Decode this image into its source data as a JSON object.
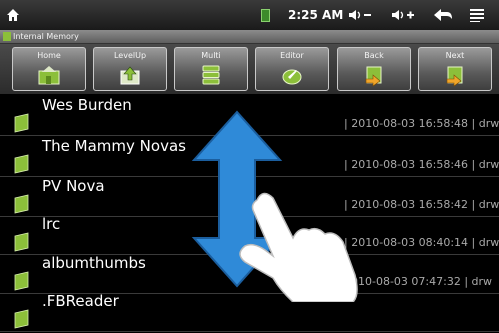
{
  "status": {
    "time": "2:25 AM",
    "icons": [
      "home-icon",
      "battery-icon",
      "volume-down-icon",
      "volume-up-icon",
      "back-arrow-icon",
      "menu-icon"
    ],
    "volume_down_label": "◀)−",
    "volume_up_label": "◀)+"
  },
  "path": {
    "label": "Internal Memory"
  },
  "toolbar": {
    "buttons": [
      {
        "label": "Home",
        "icon": "home-folder-icon"
      },
      {
        "label": "LevelUp",
        "icon": "level-up-icon"
      },
      {
        "label": "Multi",
        "icon": "multi-select-icon"
      },
      {
        "label": "Editor",
        "icon": "editor-icon"
      },
      {
        "label": "Back",
        "icon": "back-folder-icon"
      },
      {
        "label": "Next",
        "icon": "next-folder-icon"
      }
    ]
  },
  "files": [
    {
      "name": "Wes Burden",
      "meta": "| 2010-08-03 16:58:48 | drw"
    },
    {
      "name": "The Mammy Novas",
      "meta": "| 2010-08-03 16:58:46 | drw"
    },
    {
      "name": "PV Nova",
      "meta": "| 2010-08-03 16:58:42 | drw"
    },
    {
      "name": "lrc",
      "meta": "| 2010-08-03 08:40:14 | drw"
    },
    {
      "name": "albumthumbs",
      "meta": "2010-08-03 07:47:32 | drw"
    },
    {
      "name": ".FBReader",
      "meta": ""
    }
  ],
  "colors": {
    "folder": "#8cbf3a",
    "arrow": "#2f8ad8",
    "text_meta": "#a9a9a9"
  }
}
